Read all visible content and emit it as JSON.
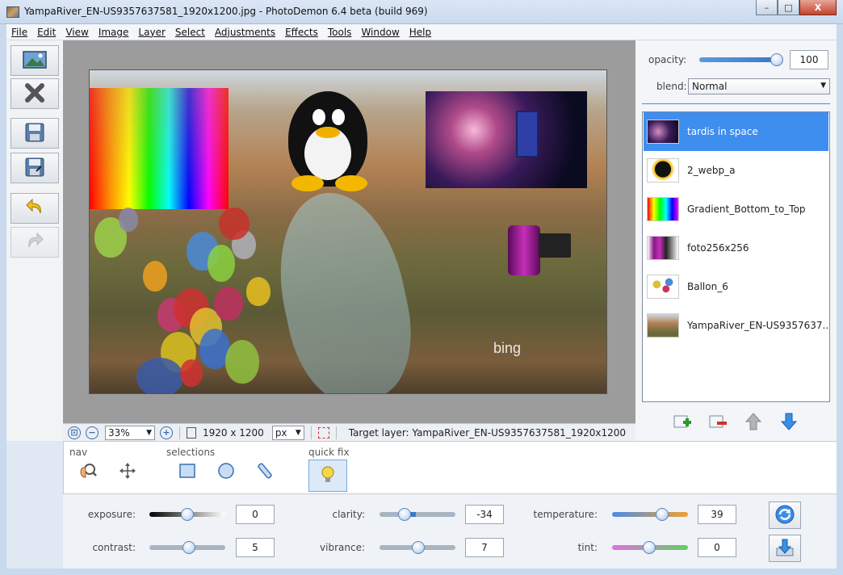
{
  "window": {
    "title": "YampaRiver_EN-US9357637581_1920x1200.jpg  -  PhotoDemon 6.4 beta (build 969)",
    "minimize": "–",
    "maximize": "□",
    "close": "X"
  },
  "menu": [
    "File",
    "Edit",
    "View",
    "Image",
    "Layer",
    "Select",
    "Adjustments",
    "Effects",
    "Tools",
    "Window",
    "Help"
  ],
  "left_toolbar": {
    "items": [
      {
        "name": "open-image",
        "icon": "image-icon",
        "enabled": true
      },
      {
        "name": "close-image",
        "icon": "close-x-icon",
        "enabled": true
      },
      {
        "name": "save",
        "icon": "floppy-icon",
        "enabled": true
      },
      {
        "name": "save-as",
        "icon": "floppy-as-icon",
        "enabled": true
      },
      {
        "name": "undo",
        "icon": "undo-arrow-icon",
        "enabled": true
      },
      {
        "name": "redo",
        "icon": "redo-arrow-icon",
        "enabled": false
      }
    ]
  },
  "canvas": {
    "watermark": "bing"
  },
  "statusbar": {
    "zoom": "33%",
    "dimensions": "1920 x 1200",
    "unit": "px",
    "target_layer": "Target layer: YampaRiver_EN-US9357637581_1920x1200"
  },
  "layer_props": {
    "opacity_label": "opacity:",
    "opacity_value": "100",
    "opacity_fraction": 1.0,
    "blend_label": "blend:",
    "blend_value": "Normal"
  },
  "layers": [
    {
      "name": "tardis in space",
      "selected": true
    },
    {
      "name": "2_webp_a",
      "selected": false
    },
    {
      "name": "Gradient_Bottom_to_Top",
      "selected": false
    },
    {
      "name": "foto256x256",
      "selected": false
    },
    {
      "name": "Ballon_6",
      "selected": false
    },
    {
      "name": "YampaRiver_EN-US9357637...",
      "selected": false
    }
  ],
  "toolbox": {
    "groups": [
      {
        "label": "nav"
      },
      {
        "label": "selections"
      },
      {
        "label": "quick fix"
      }
    ]
  },
  "quick_fix": {
    "exposure": {
      "label": "exposure:",
      "value": "0"
    },
    "contrast": {
      "label": "contrast:",
      "value": "5"
    },
    "clarity": {
      "label": "clarity:",
      "value": "-34"
    },
    "vibrance": {
      "label": "vibrance:",
      "value": "7"
    },
    "temperature": {
      "label": "temperature:",
      "value": "39"
    },
    "tint": {
      "label": "tint:",
      "value": "0"
    }
  },
  "colors": {
    "accent": "#3e8ef0",
    "canvas_bg": "#9c9c9c"
  }
}
